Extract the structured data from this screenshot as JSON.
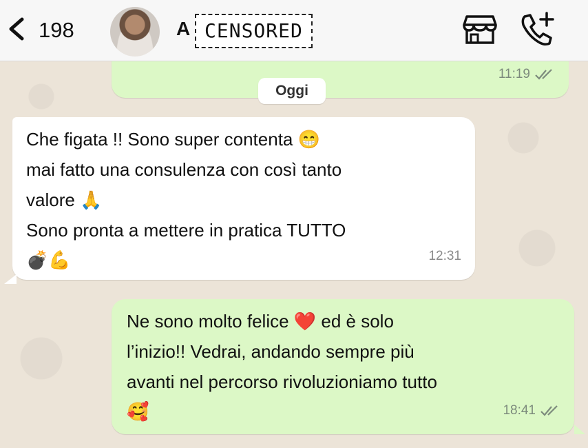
{
  "header": {
    "back_count": "198",
    "contact_name_visible": "A",
    "censored_label": "CENSORED"
  },
  "date_chip": "Oggi",
  "messages": [
    {
      "direction": "outgoing",
      "time": "11:19",
      "status": "read"
    },
    {
      "direction": "incoming",
      "lines": [
        "Che figata !! Sono super contenta 😁",
        "mai fatto una consulenza con così tanto",
        "valore 🙏",
        "Sono pronta a mettere in pratica TUTTO",
        "💣💪"
      ],
      "time": "12:31"
    },
    {
      "direction": "outgoing",
      "lines": [
        "Ne sono molto felice ❤️ ed è solo",
        "l’inizio!! Vedrai, andando sempre più",
        "avanti nel percorso rivoluzioniamo tutto",
        "🥰"
      ],
      "time": "18:41",
      "status": "read"
    }
  ],
  "colors": {
    "outgoing_bubble": "#dcf8c6",
    "incoming_bubble": "#ffffff",
    "wallpaper": "#ece4d8",
    "header_bg": "#f7f7f7"
  },
  "icons": [
    "back-chevron-icon",
    "shop-icon",
    "add-call-icon",
    "double-check-icon"
  ]
}
